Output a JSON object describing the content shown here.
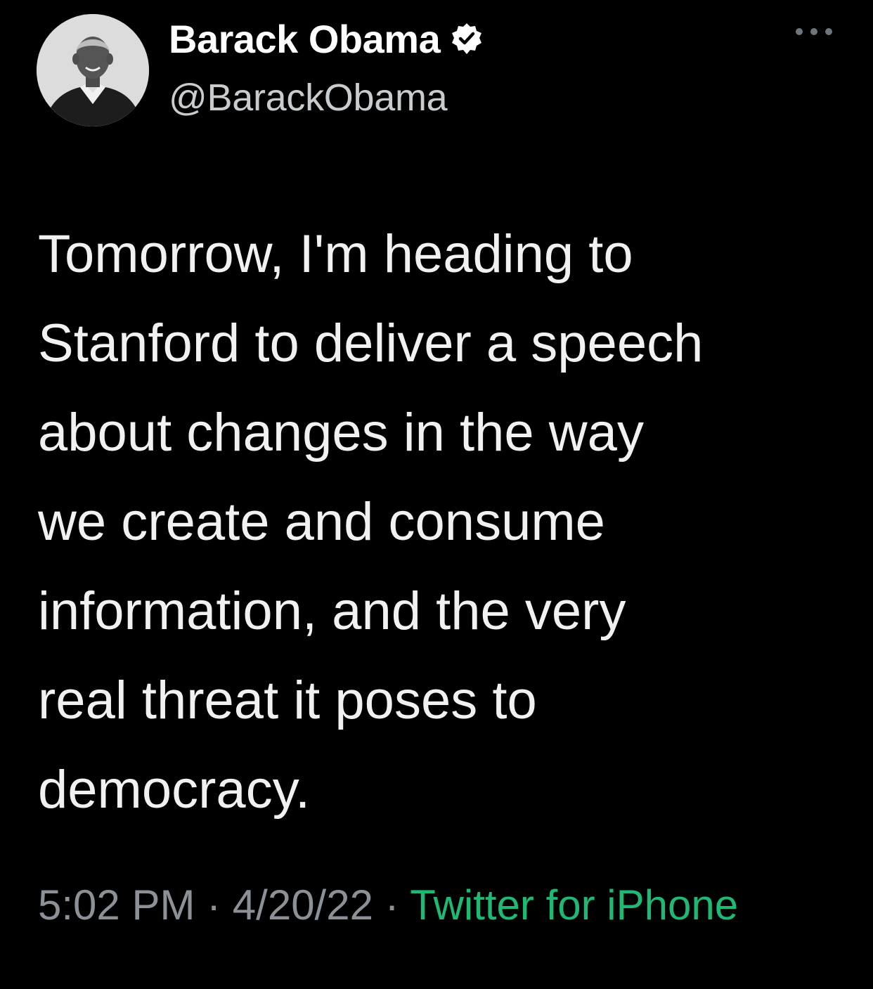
{
  "author": {
    "display_name": "Barack Obama",
    "handle": "@BarackObama",
    "verified": true,
    "avatar_icon": "profile-photo"
  },
  "menu": {
    "icon": "more-options-icon"
  },
  "tweet": {
    "text": "Tomorrow, I'm heading to\nStanford to deliver a speech\nabout changes in the way\nwe create and consume\ninformation, and the very\nreal threat it poses to\ndemocracy."
  },
  "meta": {
    "time": "5:02 PM",
    "separator": "·",
    "date": "4/20/22",
    "source": "Twitter for iPhone"
  },
  "colors": {
    "background": "#000000",
    "text": "#f1f1f1",
    "muted": "#8b9196",
    "source_link": "#1fb874"
  }
}
